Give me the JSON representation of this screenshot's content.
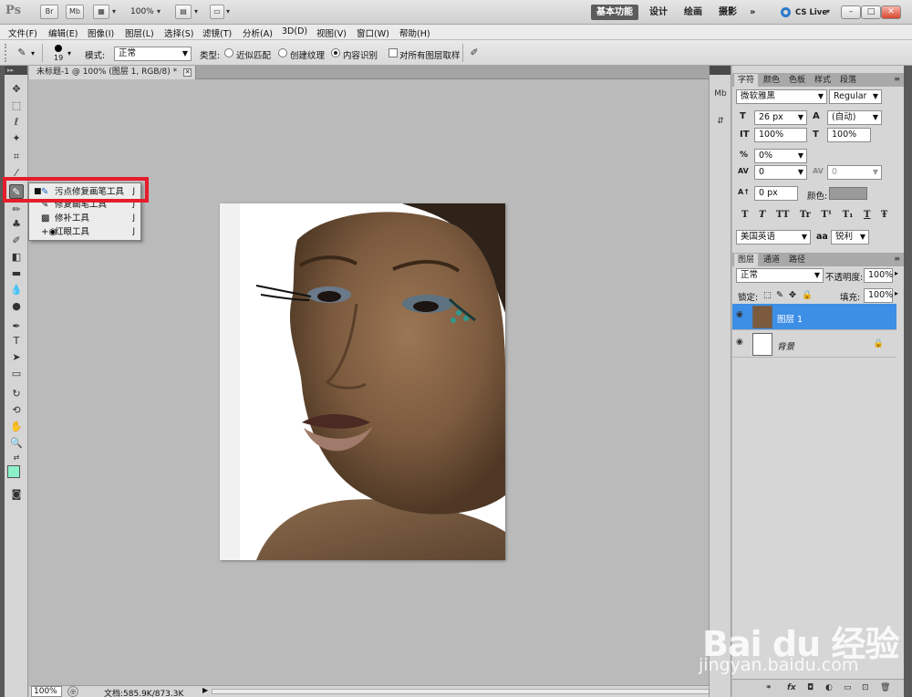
{
  "titlebar": {
    "logo": "Ps",
    "br_label": "Br",
    "mb_label": "Mb",
    "zoom": "100%",
    "workspaces": [
      "基本功能",
      "设计",
      "绘画",
      "摄影"
    ],
    "more": "»",
    "cs_live": "CS Live",
    "win_min": "–",
    "win_max": "□",
    "win_close": "✕"
  },
  "menu": [
    "文件(F)",
    "编辑(E)",
    "图像(I)",
    "图层(L)",
    "选择(S)",
    "滤镜(T)",
    "分析(A)",
    "3D(D)",
    "视图(V)",
    "窗口(W)",
    "帮助(H)"
  ],
  "options": {
    "brush_size": "19",
    "mode_label": "模式:",
    "mode_value": "正常",
    "type_label": "类型:",
    "radio_proximity": "近似匹配",
    "radio_texture": "创建纹理",
    "radio_content": "内容识别",
    "sample_all": "对所有图层取样"
  },
  "document": {
    "tab_title": "未标题-1 @ 100% (图层 1, RGB/8) *",
    "status_zoom": "100%",
    "status_info": "文档:585.9K/873.3K"
  },
  "flyout": {
    "items": [
      {
        "name": "污点修复画笔工具",
        "key": "J"
      },
      {
        "name": "修复画笔工具",
        "key": "J"
      },
      {
        "name": "修补工具",
        "key": "J"
      },
      {
        "name": "红眼工具",
        "key": "J"
      }
    ]
  },
  "character_panel": {
    "tabs": [
      "字符",
      "颜色",
      "色板",
      "样式",
      "段落"
    ],
    "font_family": "微软雅黑",
    "font_style": "Regular",
    "font_size": "26 px",
    "leading": "(自动)",
    "vertical_scale": "100%",
    "horizontal_scale": "100%",
    "tracking_pct": "0%",
    "kerning": "0",
    "tracking": "0",
    "baseline": "0 px",
    "color_label": "颜色:",
    "language": "美国英语",
    "aa_symbol": "aa",
    "antialias": "锐利",
    "styles": [
      "T",
      "T",
      "TT",
      "Tr",
      "T¹",
      "T₁",
      "T",
      "Ŧ"
    ]
  },
  "layers_panel": {
    "tabs": [
      "图层",
      "通道",
      "路径"
    ],
    "blend_mode": "正常",
    "opacity_label": "不透明度:",
    "opacity": "100%",
    "lock_label": "锁定:",
    "fill_label": "填充:",
    "fill": "100%",
    "layers": [
      {
        "name": "图层 1"
      },
      {
        "name": "背景"
      }
    ]
  },
  "watermark": {
    "brand": "Bai du 经验",
    "url": "jingyan.baidu.com"
  },
  "colors": {
    "accent": "#3d8fe6",
    "highlight_box": "#e61c2a",
    "foreground": "#8cf0c8"
  }
}
